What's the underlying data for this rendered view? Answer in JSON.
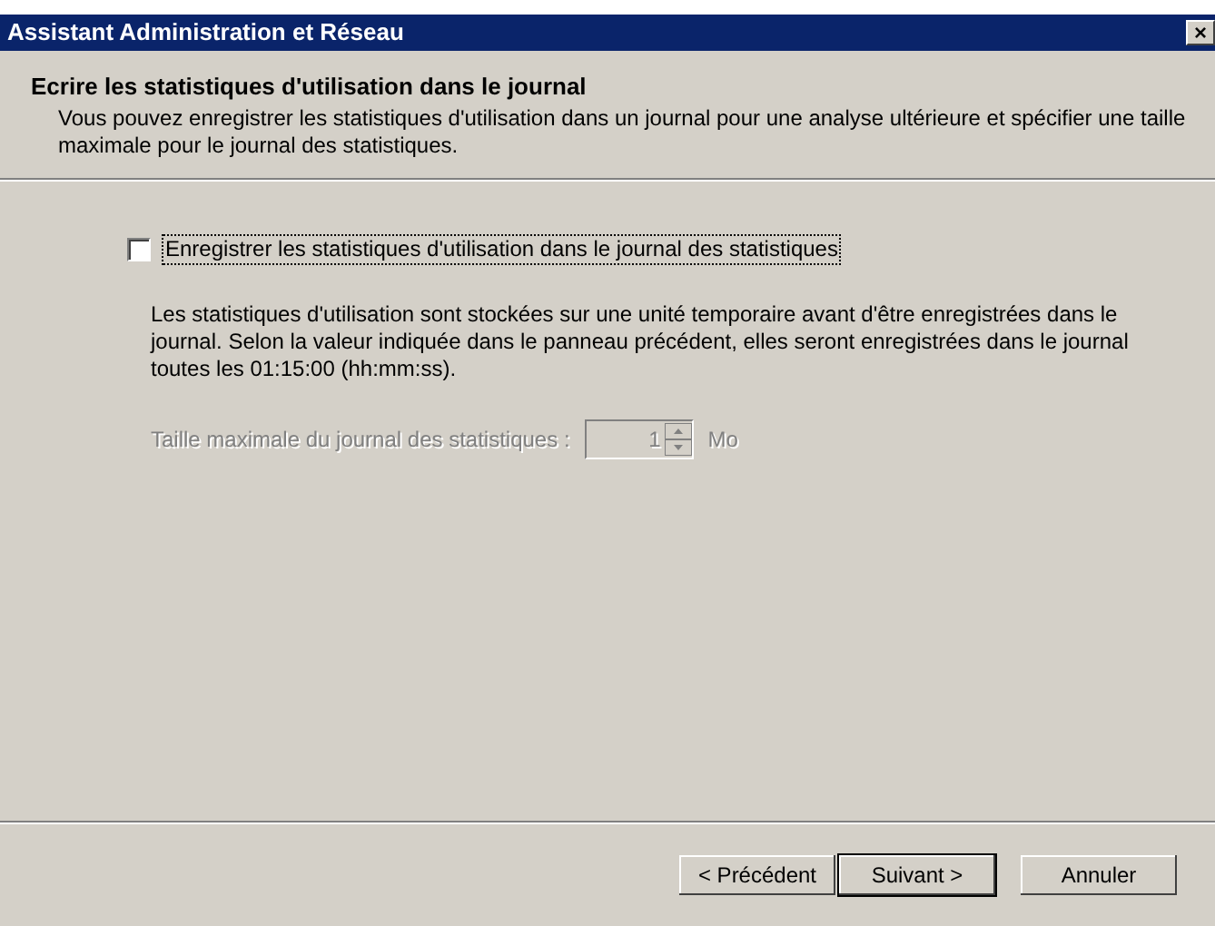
{
  "window": {
    "title": "Assistant Administration et Réseau",
    "close": "×"
  },
  "header": {
    "title": "Ecrire les statistiques d'utilisation dans le journal",
    "subtitle": "Vous pouvez enregistrer les statistiques d'utilisation dans un journal pour une analyse ultérieure et spécifier une taille maximale pour le journal des statistiques."
  },
  "log_checkbox": {
    "label": "Enregistrer les statistiques d'utilisation dans le journal des statistiques",
    "checked": false
  },
  "description": "Les statistiques d'utilisation sont stockées sur une unité temporaire avant d'être enregistrées dans le journal. Selon la valeur indiquée dans le panneau précédent, elles seront enregistrées dans le journal toutes les 01:15:00 (hh:mm:ss).",
  "max_size": {
    "label": "Taille maximale du journal des statistiques :",
    "value": "1",
    "unit": "Mo",
    "disabled": true
  },
  "buttons": [
    {
      "label": "< Précédent",
      "default": false
    },
    {
      "label": "Suivant >",
      "default": true
    },
    {
      "label": "Annuler",
      "default": false
    }
  ]
}
